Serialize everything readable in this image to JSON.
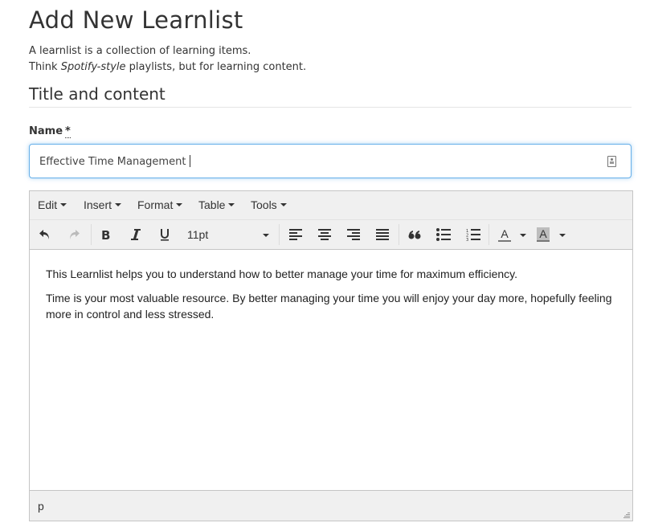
{
  "page": {
    "title": "Add New Learnlist",
    "intro_line1": "A learnlist is a collection of learning items.",
    "intro_line2_prefix": "Think ",
    "intro_line2_em": "Spotify-style",
    "intro_line2_suffix": " playlists, but for learning content.",
    "section_title": "Title and content"
  },
  "name_field": {
    "label": "Name",
    "required_marker": "*",
    "value": "Effective Time Management",
    "icon": "contact-card-icon"
  },
  "editor": {
    "menus": [
      {
        "label": "Edit"
      },
      {
        "label": "Insert"
      },
      {
        "label": "Format"
      },
      {
        "label": "Table"
      },
      {
        "label": "Tools"
      }
    ],
    "toolbar": {
      "undo": "undo-icon",
      "redo": "redo-icon",
      "bold": "bold-icon",
      "italic": "italic-icon",
      "underline": "underline-icon",
      "font_size": "11pt",
      "align_left": "align-left-icon",
      "align_center": "align-center-icon",
      "align_right": "align-right-icon",
      "align_justify": "align-justify-icon",
      "blockquote": "blockquote-icon",
      "bullet_list": "bullet-list-icon",
      "numbered_list": "numbered-list-icon",
      "text_color_letter": "A",
      "bg_color_letter": "A"
    },
    "paragraphs": [
      "This Learnlist helps you to understand how to better manage your time for maximum efficiency.",
      "Time is your most valuable resource. By better managing your time you will enjoy your day more, hopefully feeling more in control and less stressed."
    ],
    "status_path": "p"
  }
}
